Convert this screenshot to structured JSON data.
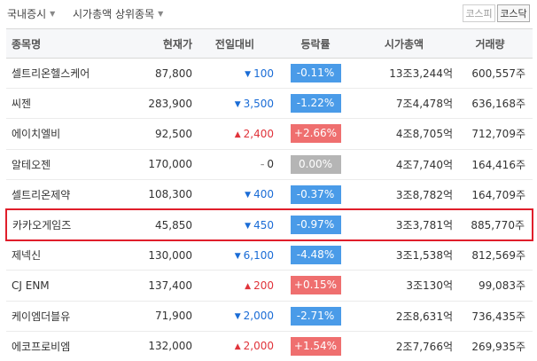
{
  "nav": {
    "market_label": "국내증시",
    "ranking_label": "시가총액 상위종목",
    "kospi_label": "코스피",
    "kosdaq_label": "코스닥"
  },
  "table": {
    "headers": {
      "name": "종목명",
      "price": "현재가",
      "change": "전일대비",
      "rate": "등락률",
      "cap": "시가총액",
      "volume": "거래량"
    },
    "rows": [
      {
        "name": "셀트리온헬스케어",
        "price": "87,800",
        "direction": "down",
        "change": "100",
        "rate": "-0.11%",
        "cap": "13조3,244억",
        "volume": "600,557주"
      },
      {
        "name": "씨젠",
        "price": "283,900",
        "direction": "down",
        "change": "3,500",
        "rate": "-1.22%",
        "cap": "7조4,478억",
        "volume": "636,168주"
      },
      {
        "name": "에이치엘비",
        "price": "92,500",
        "direction": "up",
        "change": "2,400",
        "rate": "+2.66%",
        "cap": "4조8,705억",
        "volume": "712,709주"
      },
      {
        "name": "알테오젠",
        "price": "170,000",
        "direction": "flat",
        "change": "0",
        "rate": "0.00%",
        "cap": "4조7,740억",
        "volume": "164,416주"
      },
      {
        "name": "셀트리온제약",
        "price": "108,300",
        "direction": "down",
        "change": "400",
        "rate": "-0.37%",
        "cap": "3조8,782억",
        "volume": "164,709주"
      },
      {
        "name": "카카오게임즈",
        "price": "45,850",
        "direction": "down",
        "change": "450",
        "rate": "-0.97%",
        "cap": "3조3,781억",
        "volume": "885,770주"
      },
      {
        "name": "제넥신",
        "price": "130,000",
        "direction": "down",
        "change": "6,100",
        "rate": "-4.48%",
        "cap": "3조1,538억",
        "volume": "812,569주"
      },
      {
        "name": "CJ ENM",
        "price": "137,400",
        "direction": "up",
        "change": "200",
        "rate": "+0.15%",
        "cap": "3조130억",
        "volume": "99,083주"
      },
      {
        "name": "케이엠더블유",
        "price": "71,900",
        "direction": "down",
        "change": "2,000",
        "rate": "-2.71%",
        "cap": "2조8,631억",
        "volume": "736,435주"
      },
      {
        "name": "에코프로비엠",
        "price": "132,000",
        "direction": "up",
        "change": "2,000",
        "rate": "+1.54%",
        "cap": "2조7,766억",
        "volume": "269,935주"
      }
    ],
    "highlighted_row": "카카오게임즈"
  },
  "colors": {
    "down": "#1a6cd6",
    "up": "#e0333a",
    "highlight_border": "#e01e2b"
  },
  "icons": {
    "down": "down-triangle-icon",
    "up": "up-triangle-icon",
    "flat": "dash-icon"
  }
}
